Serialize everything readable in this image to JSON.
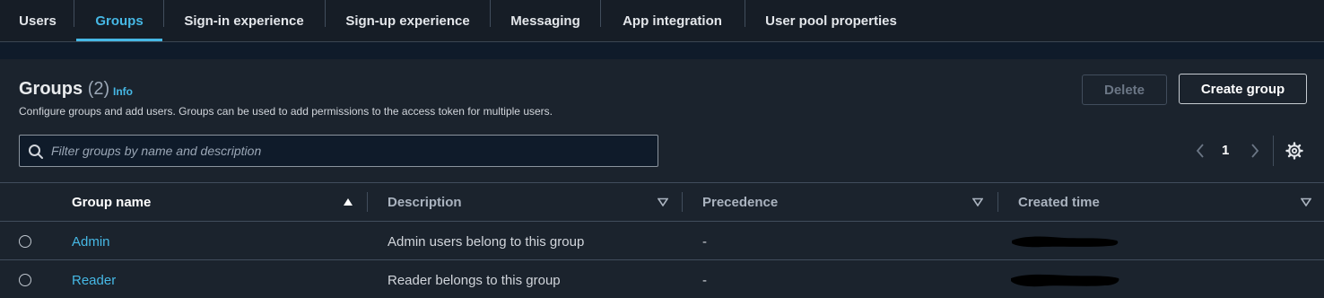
{
  "tabs": [
    {
      "label": "Users",
      "active": false
    },
    {
      "label": "Groups",
      "active": true
    },
    {
      "label": "Sign-in experience",
      "active": false
    },
    {
      "label": "Sign-up experience",
      "active": false
    },
    {
      "label": "Messaging",
      "active": false
    },
    {
      "label": "App integration",
      "active": false
    },
    {
      "label": "User pool properties",
      "active": false
    }
  ],
  "header": {
    "title": "Groups",
    "count": "(2)",
    "info": "Info",
    "description": "Configure groups and add users. Groups can be used to add permissions to the access token for multiple users."
  },
  "actions": {
    "delete_label": "Delete",
    "create_label": "Create group"
  },
  "search": {
    "placeholder": "Filter groups by name and description",
    "icon": "search-icon"
  },
  "pagination": {
    "current_page": "1",
    "prev_icon": "chevron-left-icon",
    "next_icon": "chevron-right-icon",
    "settings_icon": "gear-icon"
  },
  "table": {
    "columns": [
      {
        "label": "Group name",
        "sort": "ascending"
      },
      {
        "label": "Description",
        "sort": "none"
      },
      {
        "label": "Precedence",
        "sort": "none"
      },
      {
        "label": "Created time",
        "sort": "none"
      }
    ],
    "rows": [
      {
        "name": "Admin",
        "description": "Admin users belong to this group",
        "precedence": "-",
        "created_time_redacted": true
      },
      {
        "name": "Reader",
        "description": "Reader belongs to this group",
        "precedence": "-",
        "created_time_redacted": true
      }
    ]
  },
  "colors": {
    "accent": "#46b8e5",
    "background": "#0f1b2a",
    "panel": "#1b232d"
  }
}
